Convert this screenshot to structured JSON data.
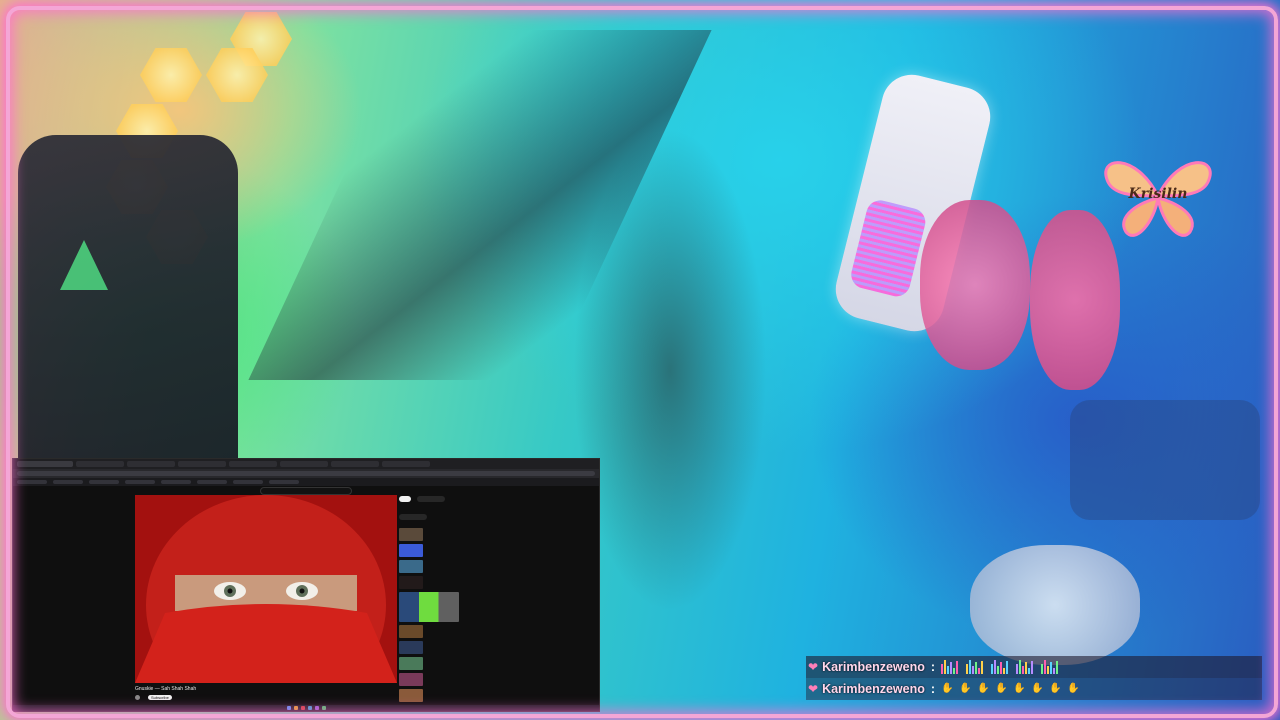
{
  "stream": {
    "channel_logo_text": "Krisilin"
  },
  "browser": {
    "window_title": "",
    "search_query": "",
    "video_title": "Gnuskie — Sah Shah Shah",
    "channel_name": "",
    "subscribe_label": "Subscribe",
    "recommendations_count": 10
  },
  "chat": {
    "messages": [
      {
        "username": "Karimbenzeweno",
        "emote_type": "equalizer",
        "emote_count": 5
      },
      {
        "username": "Karimbenzeweno",
        "emote_type": "hand",
        "emote_count": 8
      }
    ],
    "separator": ":"
  },
  "colors": {
    "frame": "#f4a6d6",
    "frame_glow": "#ff6fd0",
    "username": "#ffd7ec",
    "heart": "#ff7fb8"
  }
}
